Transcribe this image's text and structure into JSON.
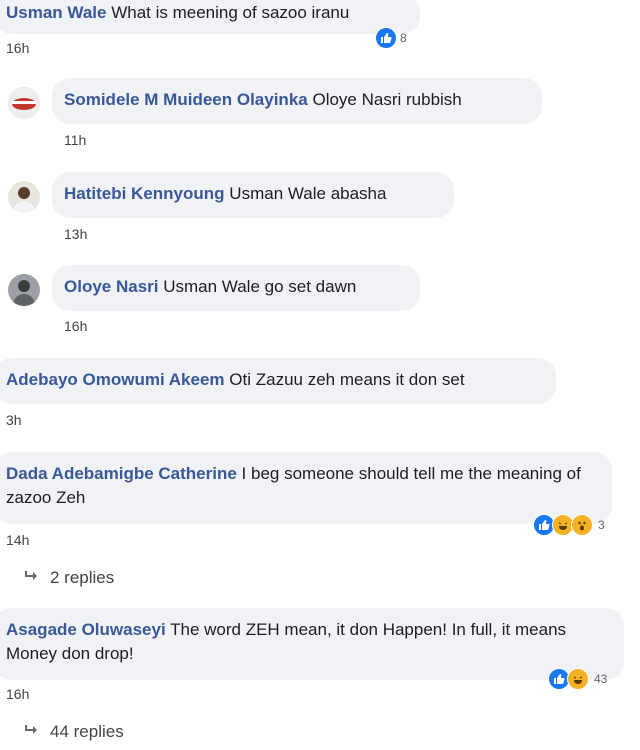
{
  "comments": [
    {
      "author": "Usman Wale",
      "text": "What is meening of sazoo iranu",
      "time": "16h",
      "reactions": {
        "count": "8"
      }
    },
    {
      "author": "Somidele M Muideen Olayinka",
      "text": "Oloye Nasri rubbish",
      "time": "11h"
    },
    {
      "author": "Hatitebi Kennyoung",
      "text": "Usman Wale abasha",
      "time": "13h"
    },
    {
      "author": "Oloye Nasri",
      "text": "Usman Wale go set dawn",
      "time": "16h"
    },
    {
      "author": "Adebayo Omowumi Akeem",
      "text": "Oti Zazuu zeh means it don set",
      "time": "3h"
    },
    {
      "author": "Dada Adebamigbe Catherine",
      "text": "I beg someone should tell me the meaning of zazoo Zeh",
      "time": "14h",
      "reactions": {
        "count": "3"
      },
      "replies": "2 replies"
    },
    {
      "author": "Asagade Oluwaseyi",
      "text": "The word ZEH mean, it don Happen! In full, it means Money don drop!",
      "time": "16h",
      "reactions": {
        "count": "43"
      },
      "replies": "44 replies"
    }
  ],
  "colors": {
    "author": "#385898",
    "bubble": "#f0f2f5",
    "like": "#1877f2",
    "haha": "#f7b125"
  },
  "icons": {
    "like": "thumbs-up-icon",
    "haha": "laughing-face-icon",
    "wow": "surprised-face-icon",
    "reply": "reply-arrow-icon"
  }
}
